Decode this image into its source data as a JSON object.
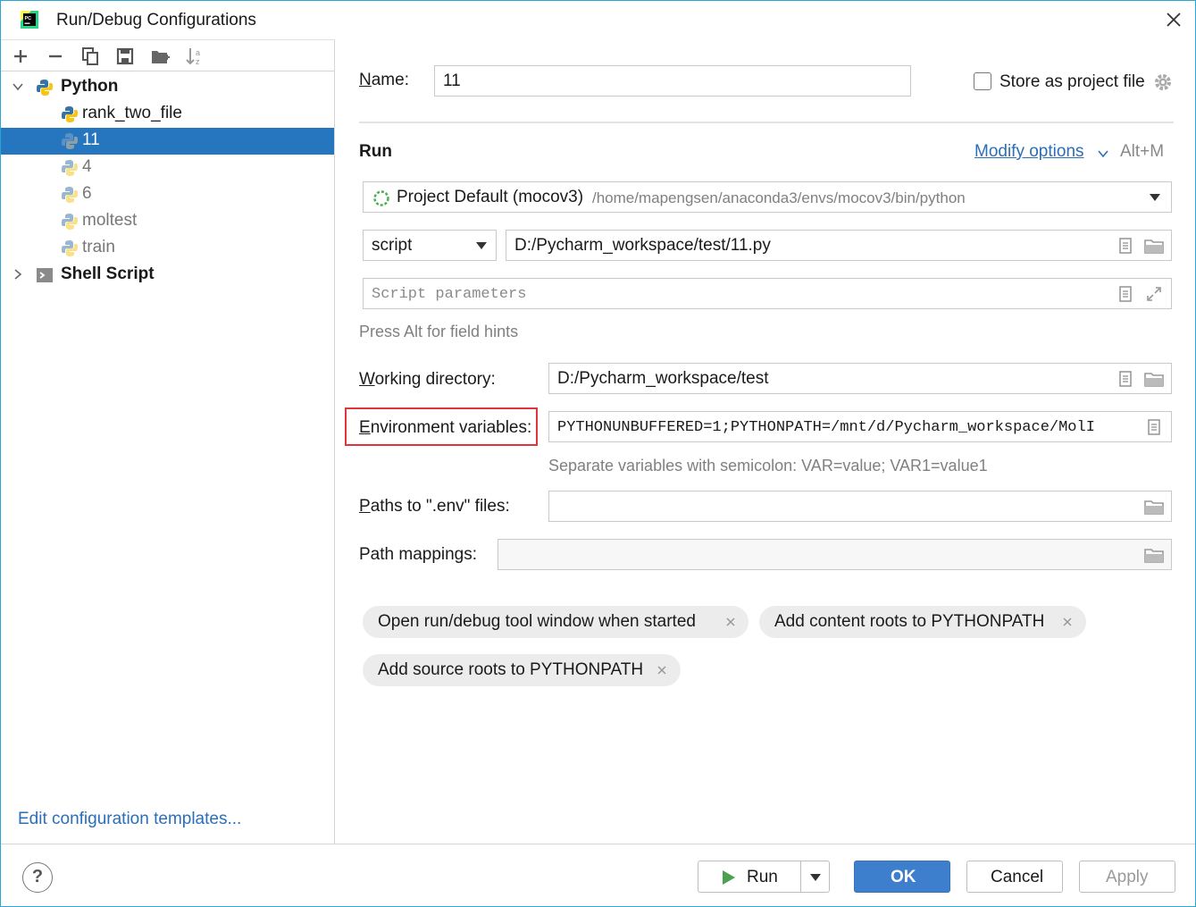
{
  "window": {
    "title": "Run/Debug Configurations"
  },
  "tree": {
    "groups": [
      {
        "label": "Python",
        "expanded": true
      },
      {
        "label": "Shell Script",
        "expanded": false
      }
    ],
    "items": [
      {
        "label": "rank_two_file"
      },
      {
        "label": "11",
        "selected": true
      },
      {
        "label": "4"
      },
      {
        "label": "6"
      },
      {
        "label": "moltest"
      },
      {
        "label": "train"
      }
    ],
    "edit_templates": "Edit configuration templates..."
  },
  "form": {
    "name_label": "Name:",
    "name_value": "11",
    "store_label": "Store as project file",
    "section_run": "Run",
    "modify_options": "Modify options",
    "modify_shortcut": "Alt+M",
    "interpreter_name": "Project Default (mocov3)",
    "interpreter_path": "/home/mapengsen/anaconda3/envs/mocov3/bin/python",
    "script_type": "script",
    "script_path": "D:/Pycharm_workspace/test/11.py",
    "script_params_placeholder": "Script parameters",
    "field_hint": "Press Alt for field hints",
    "workdir_label": "Working directory:",
    "workdir_value": "D:/Pycharm_workspace/test",
    "env_label": "Environment variables:",
    "env_value": "PYTHONUNBUFFERED=1;PYTHONPATH=/mnt/d/Pycharm_workspace/MolI",
    "env_hint": "Separate variables with semicolon: VAR=value; VAR1=value1",
    "dotenv_label": "Paths to \".env\" files:",
    "dotenv_value": "",
    "mappings_label": "Path mappings:",
    "chips": [
      "Open run/debug tool window when started",
      "Add content roots to PYTHONPATH",
      "Add source roots to PYTHONPATH"
    ]
  },
  "buttons": {
    "help": "?",
    "run": "Run",
    "ok": "OK",
    "cancel": "Cancel",
    "apply": "Apply"
  },
  "colors": {
    "selection": "#2675bf",
    "link": "#2a6fb8",
    "primary_button": "#3d7fcd",
    "highlight_border": "#e0363b"
  }
}
